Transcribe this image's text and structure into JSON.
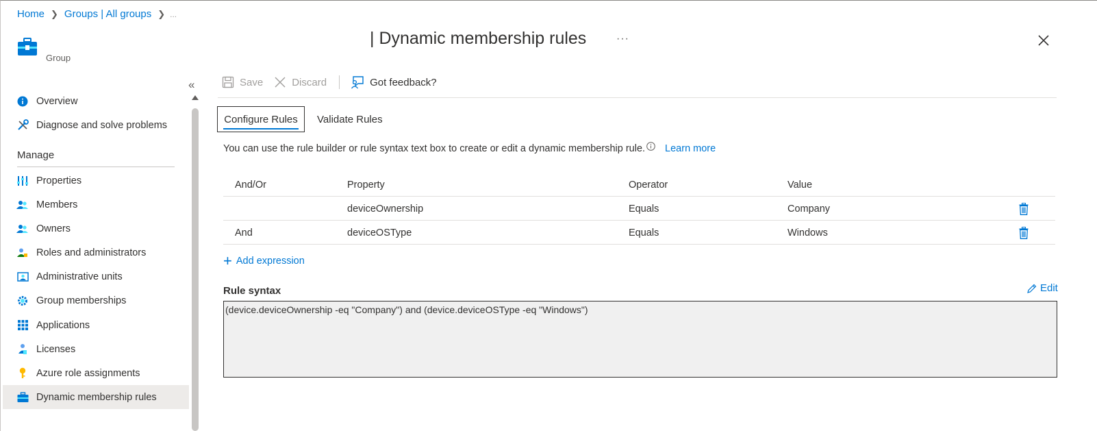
{
  "breadcrumb": {
    "home": "Home",
    "groups": "Groups | All groups",
    "tail": "..."
  },
  "header": {
    "group_label": "Group",
    "title": "| Dynamic membership rules",
    "more": "···"
  },
  "sidebar": {
    "collapse": "«",
    "top_items": [
      {
        "label": "Overview",
        "icon": "info-icon"
      },
      {
        "label": "Diagnose and solve problems",
        "icon": "wrench-icon"
      }
    ],
    "section_title": "Manage",
    "manage_items": [
      {
        "label": "Properties",
        "icon": "properties-icon"
      },
      {
        "label": "Members",
        "icon": "members-icon"
      },
      {
        "label": "Owners",
        "icon": "owners-icon"
      },
      {
        "label": "Roles and administrators",
        "icon": "roles-icon"
      },
      {
        "label": "Administrative units",
        "icon": "admin-units-icon"
      },
      {
        "label": "Group memberships",
        "icon": "gear-icon"
      },
      {
        "label": "Applications",
        "icon": "grid-icon"
      },
      {
        "label": "Licenses",
        "icon": "license-icon"
      },
      {
        "label": "Azure role assignments",
        "icon": "key-icon"
      },
      {
        "label": "Dynamic membership rules",
        "icon": "toolbox-icon",
        "active": true
      }
    ]
  },
  "toolbar": {
    "save": "Save",
    "discard": "Discard",
    "feedback": "Got feedback?"
  },
  "tabs": {
    "configure": "Configure Rules",
    "validate": "Validate Rules"
  },
  "description": {
    "text": "You can use the rule builder or rule syntax text box to create or edit a dynamic membership rule.",
    "learn_more": "Learn more"
  },
  "table": {
    "headers": [
      "And/Or",
      "Property",
      "Operator",
      "Value"
    ],
    "rows": [
      {
        "andor": "",
        "property": "deviceOwnership",
        "operator": "Equals",
        "value": "Company"
      },
      {
        "andor": "And",
        "property": "deviceOSType",
        "operator": "Equals",
        "value": "Windows"
      }
    ]
  },
  "add_expression": "Add expression",
  "rule_syntax": {
    "label": "Rule syntax",
    "edit": "Edit",
    "value": "(device.deviceOwnership -eq \"Company\") and (device.deviceOSType -eq \"Windows\")"
  },
  "colors": {
    "accent": "#0078d4",
    "text": "#323130",
    "disabled": "#a19f9d"
  }
}
